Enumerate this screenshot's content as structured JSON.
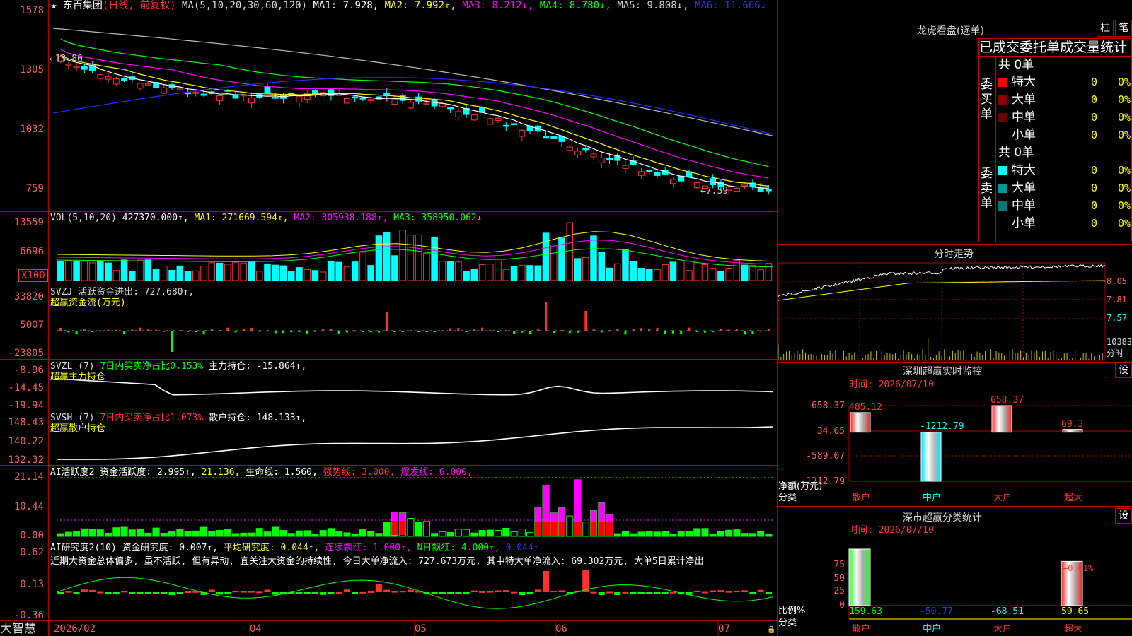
{
  "stock": {
    "name": "东百集团",
    "mode": "(日线, 前复权)",
    "ma_spec": "MA(5,10,20,30,60,120)",
    "ma": [
      {
        "label": "MA1: 7.928,",
        "color": "#ffffff"
      },
      {
        "label": "MA2: 7.992↑,",
        "color": "#ffff00"
      },
      {
        "label": "MA3: 8.212↓,",
        "color": "#ff00ff"
      },
      {
        "label": "MA4: 8.780↓,",
        "color": "#00ff00"
      },
      {
        "label": "MA5: 9.808↓,",
        "color": "#cccccc"
      },
      {
        "label": "MA6: 11.666↓",
        "color": "#3030ff"
      }
    ],
    "price_axis": [
      "1578",
      "1305",
      "1032",
      "759"
    ],
    "high_mark": "←13.80",
    "low_mark": "←7.59"
  },
  "vol": {
    "header": "VOL(5,10,20)",
    "value": "427370.000↑,",
    "ma1": "MA1: 271669.594↑,",
    "ma2": "MA2: 305938.188↑,",
    "ma3": "MA3: 358950.062↓",
    "axis": [
      "13559",
      "6696"
    ],
    "unit": "X100"
  },
  "svzj": {
    "header": "SVZJ  活跃资金进出: 727.680↑,",
    "sub": "超赢资金流(万元)",
    "axis": [
      "33820",
      "5007",
      "-23805"
    ]
  },
  "svzl": {
    "header_name": "SVZL (7)",
    "header_ratio": "7日内买卖净占比0.153%",
    "header_hold": "主力持仓: -15.864↑,",
    "sub": "超赢主力持仓",
    "axis": [
      "-8.96",
      "-14.45",
      "-19.94"
    ]
  },
  "svsh": {
    "header_name": "SVSH (7)",
    "header_ratio": "7日内买卖净占比1.073%",
    "header_hold": "散户持仓: 148.133↑,",
    "sub": "超赢散户持仓",
    "axis": [
      "148.43",
      "140.22",
      "132.32"
    ]
  },
  "ai_active": {
    "header": "AI活跃度2 资金活跃度: 2.995↑,",
    "v2": "21.136,",
    "life": "生命线: 1.560,",
    "strong": "强势线: 3.000,",
    "burst": "爆发线: 6.000,",
    "axis": [
      "21.14",
      "10.44",
      "0.00"
    ]
  },
  "ai_research": {
    "header": "AI研究度2(10) 资金研究度: 0.007↑,",
    "avg": "平均研究度: 0.044↑,",
    "cont": "连续飘红: 1.000↑,",
    "nday": "N日飘红: 4.000↑,",
    "last": "0.044↑",
    "comment": "近期大资金总体偏多, 虽不活跃, 但有异动, 宜关注大资金的持续性, 今日大单净流入: 727.673万元, 其中特大单净流入: 69.302万元, 大单5日累计净出",
    "axis": [
      "0.62",
      "0.13",
      "-0.36"
    ]
  },
  "time_axis": [
    "2026/02",
    "04",
    "05",
    "06",
    "07"
  ],
  "brand": "大智慧",
  "lhb": {
    "title": "龙虎看盘(逐单)",
    "btn_zhu": "柱",
    "btn_bi": "笔",
    "subtitle": "已成交委托单成交量统计",
    "buy_label": "委买单",
    "sell_label": "委卖单",
    "buy_total": "共 0单",
    "sell_total": "共 0单",
    "rows": [
      {
        "label": "特大",
        "count": "0",
        "pct": "0%",
        "color": "#ff0000"
      },
      {
        "label": "大单",
        "count": "0",
        "pct": "0%",
        "color": "#8b0000"
      },
      {
        "label": "中单",
        "count": "0",
        "pct": "0%",
        "color": "#6b0000"
      },
      {
        "label": "小单",
        "count": "0",
        "pct": "0%",
        "color": ""
      }
    ],
    "sell_rows": [
      {
        "label": "特大",
        "count": "0",
        "pct": "0%",
        "color": "#00ffff"
      },
      {
        "label": "大单",
        "count": "0",
        "pct": "0%",
        "color": "#009999"
      },
      {
        "label": "中单",
        "count": "0",
        "pct": "0%",
        "color": "#007777"
      },
      {
        "label": "小单",
        "count": "0",
        "pct": "0%",
        "color": ""
      }
    ]
  },
  "fenshi": {
    "title": "分时走势",
    "axis": [
      "8.05",
      "7.81",
      "7.57"
    ],
    "vol_axis": "10383",
    "unit": "分时"
  },
  "monitor": {
    "title": "深圳超赢实时监控",
    "btn": "设",
    "time": "时间: 2026/07/10",
    "axis": [
      "658.37",
      "34.65",
      "-589.07",
      "-1212.79"
    ],
    "ylabel": "净额(万元)",
    "xlabel": "分类",
    "bars": [
      {
        "cat": "散户",
        "value": 485.12,
        "label": "485.12"
      },
      {
        "cat": "中户",
        "value": -1212.79,
        "label": "-1212.79"
      },
      {
        "cat": "大户",
        "value": 658.37,
        "label": "658.37"
      },
      {
        "cat": "超大",
        "value": 69.3,
        "label": "69.3"
      }
    ]
  },
  "classify": {
    "title": "深市超赢分类统计",
    "btn": "设",
    "time": "时间: 2026/07/10",
    "axis": [
      "75",
      "50",
      "25",
      "0"
    ],
    "ylabel": "比例%",
    "xlabel": "分类",
    "top_label": "+0.01%",
    "bars": [
      {
        "cat": "散户",
        "value": 159.63,
        "label": "159.63"
      },
      {
        "cat": "中户",
        "value": -50.77,
        "label": "-50.77"
      },
      {
        "cat": "大户",
        "value": -68.51,
        "label": "-68.51"
      },
      {
        "cat": "超大",
        "value": 59.65,
        "label": "59.65"
      }
    ]
  }
}
